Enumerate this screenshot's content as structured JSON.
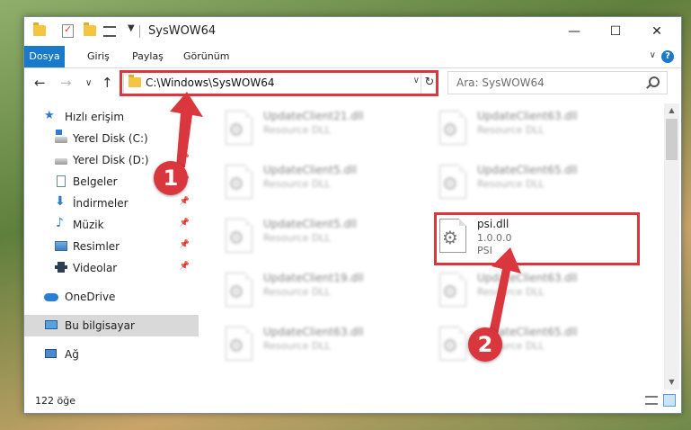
{
  "titlebar": {
    "title": "SysWOW64",
    "minimize": "—",
    "maximize": "☐",
    "close": "✕",
    "dropdown_glyph": "▼"
  },
  "ribbon": {
    "tabs": [
      "Dosya",
      "Giriş",
      "Paylaş",
      "Görünüm"
    ],
    "help": "?",
    "collapse_glyph": "∨"
  },
  "navigation": {
    "back": "←",
    "forward": "→",
    "recent": "∨",
    "up": "↑"
  },
  "address": {
    "path": "C:\\Windows\\SysWOW64",
    "dropdown": "∨",
    "refresh": "↻"
  },
  "search": {
    "placeholder": "Ara: SysWOW64"
  },
  "sidebar": {
    "items": [
      {
        "label": "Hızlı erişim",
        "icon": "star-icon"
      },
      {
        "label": "Yerel Disk (C:)",
        "icon": "drive-icon",
        "pinned": true
      },
      {
        "label": "Yerel Disk (D:)",
        "icon": "drive-icon",
        "pinned": true
      },
      {
        "label": "Belgeler",
        "icon": "documents-icon",
        "pinned": true
      },
      {
        "label": "İndirmeler",
        "icon": "downloads-icon",
        "pinned": true
      },
      {
        "label": "Müzik",
        "icon": "music-icon",
        "pinned": true
      },
      {
        "label": "Resimler",
        "icon": "pictures-icon",
        "pinned": true
      },
      {
        "label": "Videolar",
        "icon": "videos-icon",
        "pinned": true
      },
      {
        "label": "OneDrive",
        "icon": "onedrive-icon"
      },
      {
        "label": "Bu bilgisayar",
        "icon": "computer-icon",
        "selected": true
      },
      {
        "label": "Ağ",
        "icon": "network-icon"
      }
    ],
    "pin_glyph": "📌"
  },
  "files": [
    {
      "name": "UpdateClient21.dll",
      "line1": "Resource DLL",
      "line2": ""
    },
    {
      "name": "UpdateClient63.dll",
      "line1": "Resource DLL",
      "line2": ""
    },
    {
      "name": "UpdateClient5.dll",
      "line1": "Resource DLL",
      "line2": ""
    },
    {
      "name": "UpdateClient65.dll",
      "line1": "Resource DLL",
      "line2": ""
    },
    {
      "name": "UpdateClient5.dll",
      "line1": "Resource DLL",
      "line2": ""
    },
    {
      "name": "psi.dll",
      "line1": "1.0.0.0",
      "line2": "PSI"
    },
    {
      "name": "UpdateClient19.dll",
      "line1": "Resource DLL",
      "line2": ""
    },
    {
      "name": "UpdateClient63.dll",
      "line1": "Resource DLL",
      "line2": ""
    },
    {
      "name": "UpdateClient63.dll",
      "line1": "Resource DLL",
      "line2": ""
    },
    {
      "name": "UpdateClient65.dll",
      "line1": "Resource DLL",
      "line2": ""
    }
  ],
  "statusbar": {
    "count": "122 öğe"
  },
  "annotations": {
    "marker1": "1",
    "marker2": "2",
    "color": "#d9363e"
  }
}
